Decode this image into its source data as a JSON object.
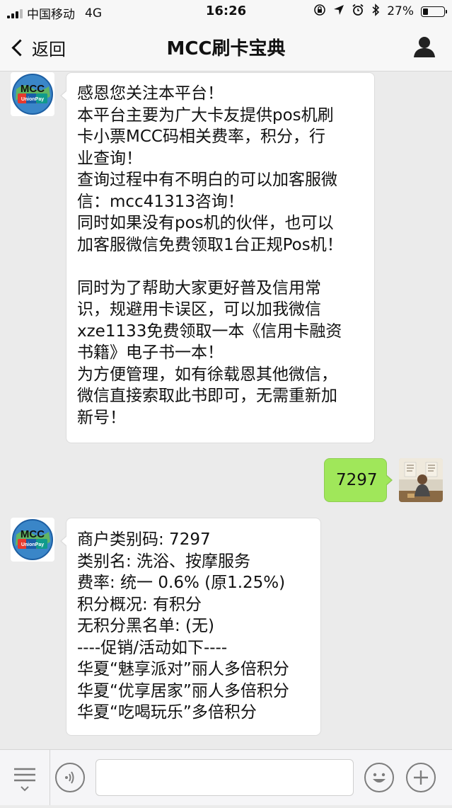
{
  "status_bar": {
    "carrier": "中国移动",
    "network": "4G",
    "time": "16:26",
    "battery": "27%",
    "battery_level": 0.27
  },
  "nav": {
    "back_label": "返回",
    "title": "MCC刷卡宝典"
  },
  "messages": [
    {
      "sender": "bot",
      "lines": [
        "感恩您关注本平台！",
        "本平台主要为广大卡友提供pos机刷",
        "卡小票MCC码相关费率，积分，行",
        "业查询！",
        "查询过程中有不明白的可以加客服微",
        "信：mcc41313咨询！",
        "同时如果没有pos机的伙伴，也可以",
        "加客服微信免费领取1台正规Pos机！",
        "",
        "同时为了帮助大家更好普及信用常",
        "识，规避用卡误区，可以加我微信",
        "xze1133免费领取一本《信用卡融资",
        "书籍》电子书一本！",
        "为方便管理，如有徐载恩其他微信，",
        "微信直接索取此书即可，无需重新加",
        "新号！"
      ]
    },
    {
      "sender": "user",
      "text": "7297"
    },
    {
      "sender": "bot",
      "lines": [
        "商户类别码: 7297",
        "类别名: 洗浴、按摩服务",
        "费率: 统一 0.6% (原1.25%)",
        "积分概况: 有积分",
        "无积分黑名单: (无)",
        "----促销/活动如下----",
        "华夏“魅享派对”丽人多倍积分",
        "华夏“优享居家”丽人多倍积分",
        "华夏“吃喝玩乐”多倍积分"
      ]
    }
  ],
  "bot_avatar": {
    "logo_text": "MCC",
    "logo_subtext": "UnionPay"
  },
  "input": {
    "value": "",
    "placeholder": ""
  },
  "colors": {
    "chat_bg": "#ebebeb",
    "bubble_in": "#ffffff",
    "bubble_out": "#a0e75a",
    "nav_bg": "#f7f7f7"
  }
}
